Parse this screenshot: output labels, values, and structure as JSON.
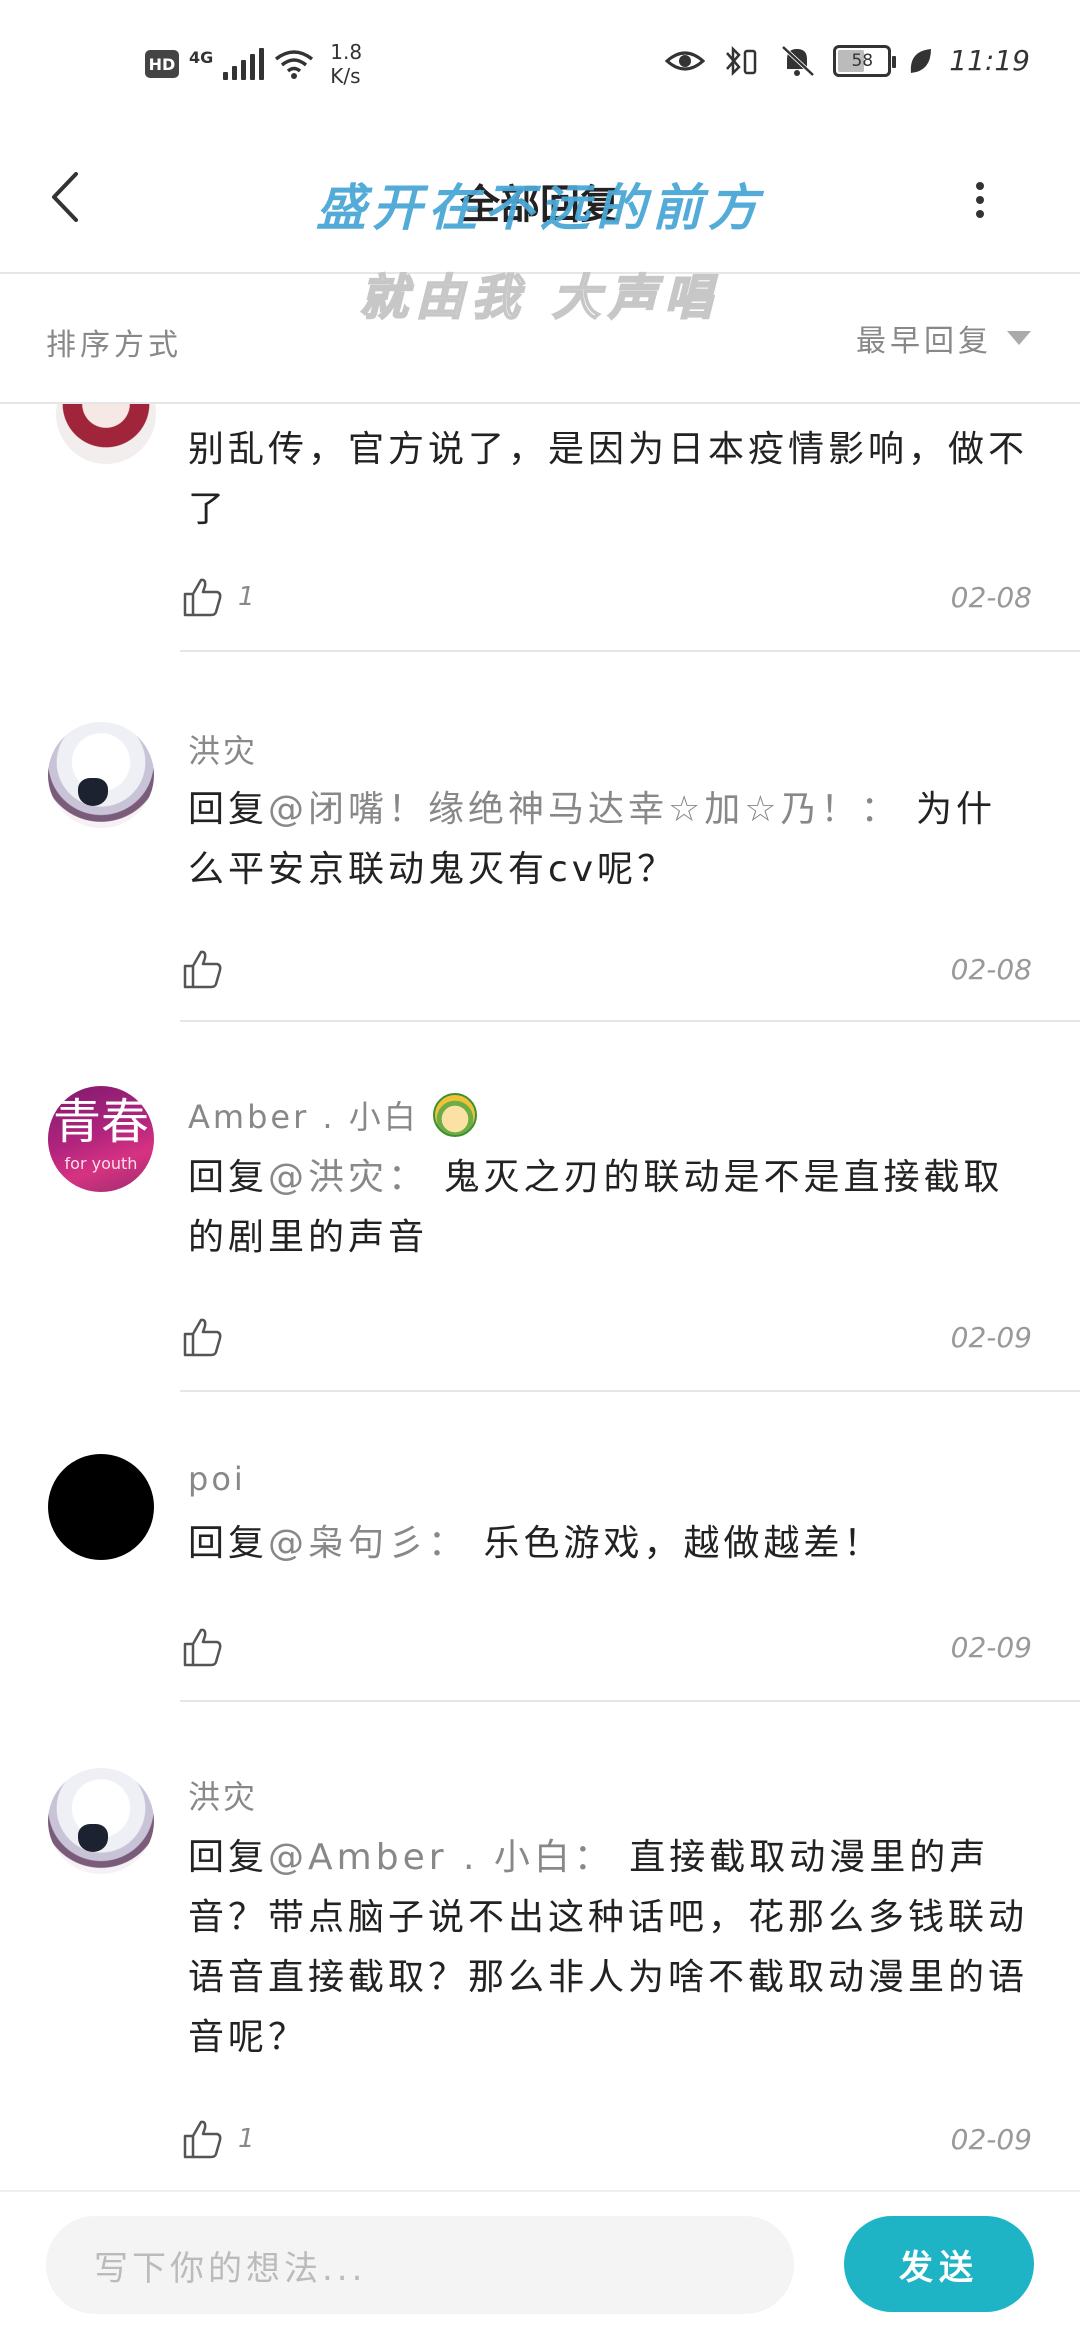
{
  "status_bar": {
    "hd": "HD",
    "network": "4G",
    "speed_value": "1.8",
    "speed_unit": "K/s",
    "battery": "58",
    "battery_level": 0.58,
    "time": "11:19"
  },
  "header": {
    "title": "全部回复",
    "back_icon": "chevron-left-icon",
    "more_icon": "more-vertical-icon"
  },
  "lyrics": {
    "line1": "盛开在不远的前方",
    "line2": "就由我 大声唱"
  },
  "sort": {
    "label": "排序方式",
    "value": "最早回复"
  },
  "comments": [
    {
      "username": "",
      "content": "别乱传，官方说了，是因为日本疫情影响，做不了",
      "likes": "1",
      "date": "02-08"
    },
    {
      "username": "洪灾",
      "reply_prefix": "回复",
      "mention": "@闭嘴！缘绝神马达幸☆加☆乃！：",
      "content": "为什么平安京联动鬼灭有cv呢？",
      "likes": "",
      "date": "02-08"
    },
    {
      "username": "Amber . 小白",
      "avatar_big": "青春",
      "avatar_small": "for youth",
      "reply_prefix": "回复",
      "mention": "@洪灾：",
      "content": "鬼灭之刃的联动是不是直接截取的剧里的声音",
      "likes": "",
      "date": "02-09"
    },
    {
      "username": "poi",
      "reply_prefix": "回复",
      "mention": "@枭句彡：",
      "content": "乐色游戏，越做越差！",
      "likes": "",
      "date": "02-09"
    },
    {
      "username": "洪灾",
      "reply_prefix": "回复",
      "mention": "@Amber . 小白：",
      "content": "直接截取动漫里的声音？带点脑子说不出这种话吧，花那么多钱联动语音直接截取？那么非人为啥不截取动漫里的语音呢？",
      "likes": "1",
      "date": "02-09"
    }
  ],
  "composer": {
    "placeholder": "写下你的想法...",
    "send_label": "发送"
  },
  "colors": {
    "accent": "#1fb3c6",
    "lyric_blue": "#4aa7d6",
    "muted_text": "#888888"
  }
}
